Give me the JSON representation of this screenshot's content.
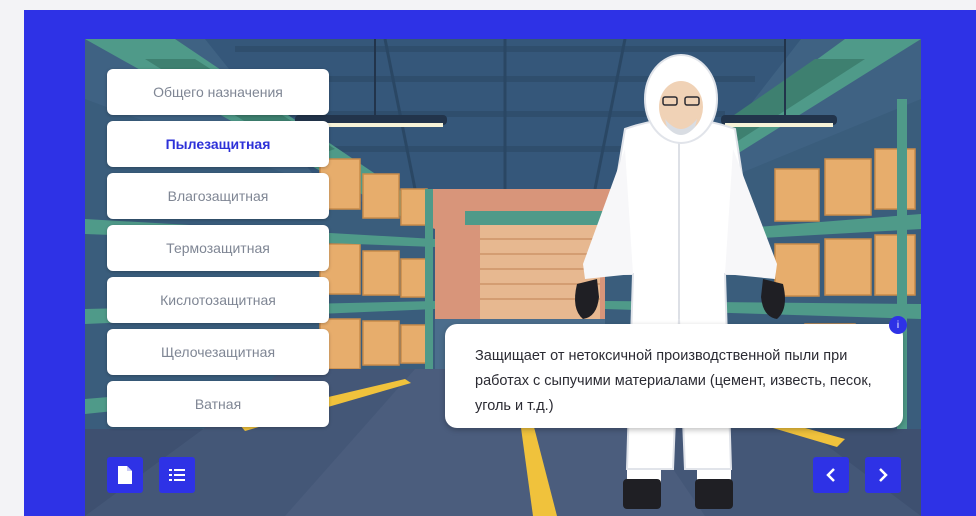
{
  "menu": {
    "items": [
      {
        "label": "Общего назначения",
        "active": false
      },
      {
        "label": "Пылезащитная",
        "active": true
      },
      {
        "label": "Влагозащитная",
        "active": false
      },
      {
        "label": "Термозащитная",
        "active": false
      },
      {
        "label": "Кислотозащитная",
        "active": false
      },
      {
        "label": "Щелочезащитная",
        "active": false
      },
      {
        "label": "Ватная",
        "active": false
      }
    ]
  },
  "info": {
    "text": "Защищает от нетоксичной производственной пыли при работах с сыпучими материалами (цемент, известь, песок, уголь и т.д.)",
    "badge": "i"
  },
  "controls": {
    "bottom_left": [
      "document-icon",
      "list-icon"
    ],
    "bottom_right": [
      "chevron-left-icon",
      "chevron-right-icon"
    ]
  },
  "colors": {
    "accent": "#2e32e6",
    "active_text": "#2d31d8",
    "inactive_text": "#7f8694"
  }
}
